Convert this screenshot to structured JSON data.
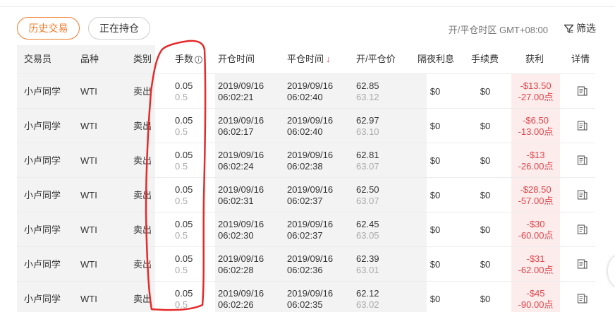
{
  "tabs": [
    {
      "label": "历史交易",
      "active": true
    },
    {
      "label": "正在持仓",
      "active": false
    }
  ],
  "timezone_label": "开/平仓时区 GMT+08:00",
  "filter_label": "筛选",
  "accent_color": "#f07b2a",
  "loss_color": "#e0454b",
  "columns": {
    "trader": "交易员",
    "symbol": "品种",
    "type": "类别",
    "lots": "手数",
    "open_time": "开仓时间",
    "close_time": "平仓时间",
    "open_close_price": "开/平仓价",
    "swap": "隔夜利息",
    "commission": "手续费",
    "profit": "获利",
    "detail": "详情"
  },
  "rows": [
    {
      "trader": "小卢同学",
      "symbol": "WTI",
      "type": "卖出",
      "lots": "0.05",
      "lots_sub": "0.5",
      "open_date": "2019/09/16",
      "open_clock": "06:02:21",
      "close_date": "2019/09/16",
      "close_clock": "06:02:40",
      "open_price": "62.85",
      "close_price": "63.12",
      "swap": "$0",
      "commission": "$0",
      "profit": "-$13.50",
      "points": "-27.00点"
    },
    {
      "trader": "小卢同学",
      "symbol": "WTI",
      "type": "卖出",
      "lots": "0.05",
      "lots_sub": "0.5",
      "open_date": "2019/09/16",
      "open_clock": "06:02:17",
      "close_date": "2019/09/16",
      "close_clock": "06:02:40",
      "open_price": "62.97",
      "close_price": "63.10",
      "swap": "$0",
      "commission": "$0",
      "profit": "-$6.50",
      "points": "-13.00点"
    },
    {
      "trader": "小卢同学",
      "symbol": "WTI",
      "type": "卖出",
      "lots": "0.05",
      "lots_sub": "0.5",
      "open_date": "2019/09/16",
      "open_clock": "06:02:24",
      "close_date": "2019/09/16",
      "close_clock": "06:02:38",
      "open_price": "62.81",
      "close_price": "63.07",
      "swap": "$0",
      "commission": "$0",
      "profit": "-$13",
      "points": "-26.00点"
    },
    {
      "trader": "小卢同学",
      "symbol": "WTI",
      "type": "卖出",
      "lots": "0.05",
      "lots_sub": "0.5",
      "open_date": "2019/09/16",
      "open_clock": "06:02:31",
      "close_date": "2019/09/16",
      "close_clock": "06:02:37",
      "open_price": "62.50",
      "close_price": "63.07",
      "swap": "$0",
      "commission": "$0",
      "profit": "-$28.50",
      "points": "-57.00点"
    },
    {
      "trader": "小卢同学",
      "symbol": "WTI",
      "type": "卖出",
      "lots": "0.05",
      "lots_sub": "0.5",
      "open_date": "2019/09/16",
      "open_clock": "06:02:30",
      "close_date": "2019/09/16",
      "close_clock": "06:02:37",
      "open_price": "62.45",
      "close_price": "63.05",
      "swap": "$0",
      "commission": "$0",
      "profit": "-$30",
      "points": "-60.00点"
    },
    {
      "trader": "小卢同学",
      "symbol": "WTI",
      "type": "卖出",
      "lots": "0.05",
      "lots_sub": "0.5",
      "open_date": "2019/09/16",
      "open_clock": "06:02:28",
      "close_date": "2019/09/16",
      "close_clock": "06:02:36",
      "open_price": "62.39",
      "close_price": "63.01",
      "swap": "$0",
      "commission": "$0",
      "profit": "-$31",
      "points": "-62.00点"
    },
    {
      "trader": "小卢同学",
      "symbol": "WTI",
      "type": "卖出",
      "lots": "0.05",
      "lots_sub": "0.5",
      "open_date": "2019/09/16",
      "open_clock": "06:02:26",
      "close_date": "2019/09/16",
      "close_clock": "06:02:35",
      "open_price": "62.12",
      "close_price": "63.02",
      "swap": "$0",
      "commission": "$0",
      "profit": "-$45",
      "points": "-90.00点"
    }
  ]
}
